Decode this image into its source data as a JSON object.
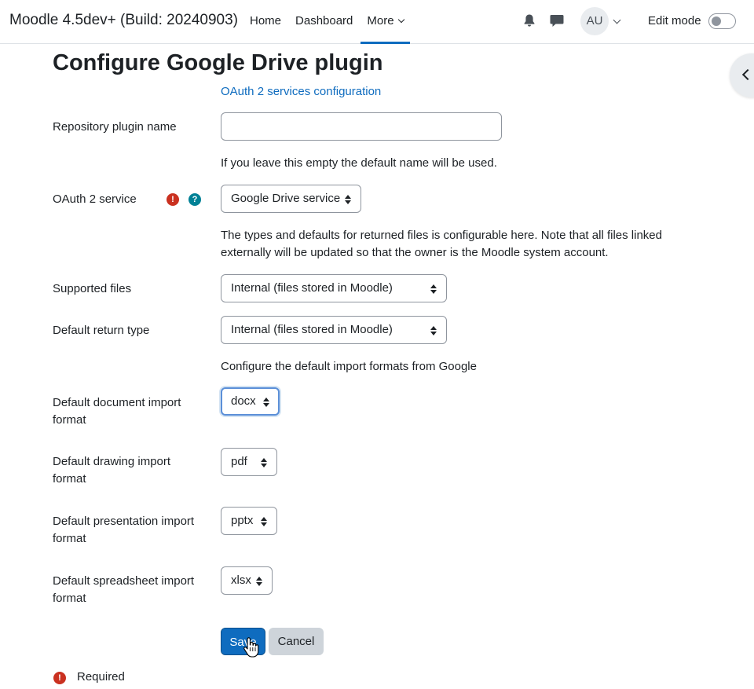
{
  "navbar": {
    "brand": "Moodle 4.5dev+ (Build: 20240903)",
    "links": [
      {
        "label": "Home"
      },
      {
        "label": "Dashboard"
      },
      {
        "label": "More"
      }
    ],
    "avatar_initials": "AU",
    "edit_mode_label": "Edit mode"
  },
  "page": {
    "title": "Configure Google Drive plugin",
    "oauth_link": "OAuth 2 services configuration"
  },
  "form": {
    "plugin_name": {
      "label": "Repository plugin name",
      "value": "",
      "help": "If you leave this empty the default name will be used."
    },
    "oauth_service": {
      "label": "OAuth 2 service",
      "value": "Google Drive service",
      "required_glyph": "!",
      "help_glyph": "?",
      "help_line1": "The types and defaults for returned files is configurable here. Note that all files linked",
      "help_line2": "externally will be updated so that the owner is the Moodle system account."
    },
    "supported_files": {
      "label": "Supported files",
      "value": "Internal (files stored in Moodle)"
    },
    "default_return_type": {
      "label": "Default return type",
      "value": "Internal (files stored in Moodle)",
      "help": "Configure the default import formats from Google"
    },
    "document_format": {
      "label_line1": "Default document import",
      "label_line2": "format",
      "value": "docx"
    },
    "drawing_format": {
      "label_line1": "Default drawing import",
      "label_line2": "format",
      "value": "pdf"
    },
    "presentation_format": {
      "label_line1": "Default presentation import",
      "label_line2": "format",
      "value": "pptx"
    },
    "spreadsheet_format": {
      "label_line1": "Default spreadsheet import",
      "label_line2": "format",
      "value": "xlsx"
    },
    "save_label": "Save",
    "cancel_label": "Cancel",
    "required_glyph": "!",
    "required_label": "Required"
  },
  "colors": {
    "primary": "#0f6cbf",
    "required": "#ca3120",
    "help": "#008196"
  },
  "icons": [
    "bell-icon",
    "chat-icon",
    "chevron-down-icon",
    "chevron-left-icon",
    "required-icon",
    "help-icon",
    "hand-cursor-icon"
  ]
}
